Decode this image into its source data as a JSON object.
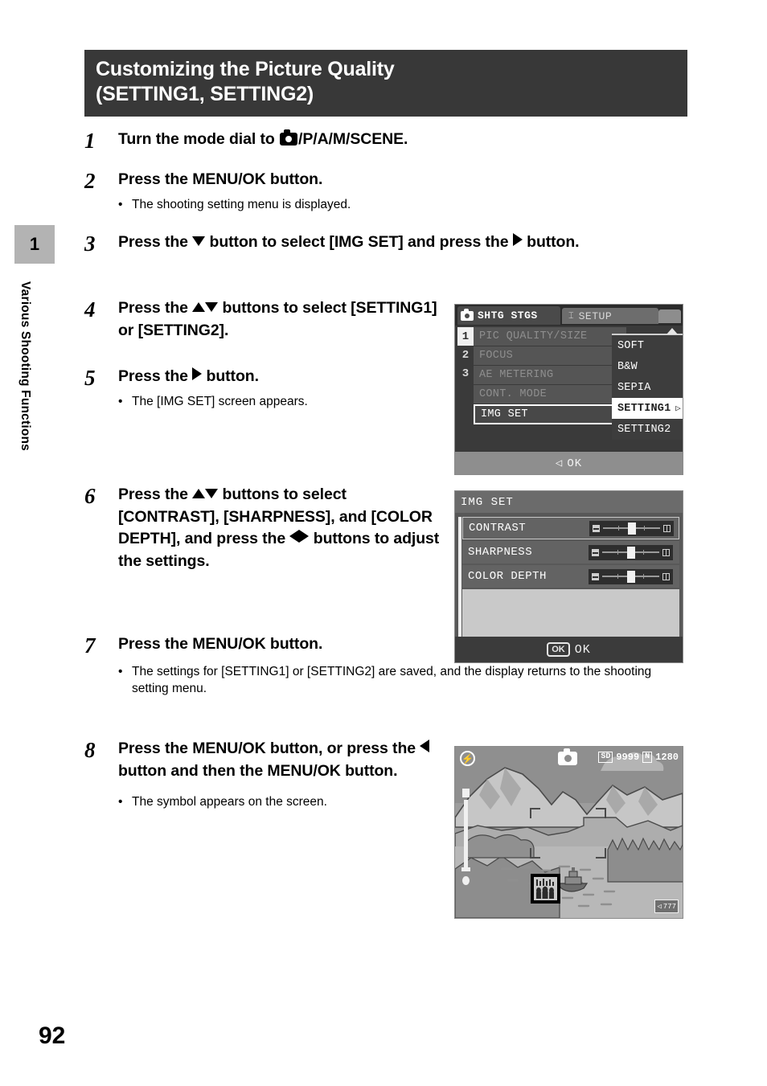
{
  "sidebar": {
    "chapter_number": "1",
    "chapter_title": "Various Shooting Functions"
  },
  "header": {
    "line1": "Customizing the Picture Quality",
    "line2": "(SETTING1, SETTING2)",
    "background": "#383838"
  },
  "page_number": "92",
  "steps": [
    {
      "number": "1",
      "text_before": "Turn the mode dial to ",
      "text_after": "/P/A/M/SCENE.",
      "bullets": []
    },
    {
      "number": "2",
      "text_before": "Press the MENU/OK button.",
      "text_after": "",
      "bullets": [
        "The shooting setting menu is displayed."
      ]
    },
    {
      "number": "3",
      "text_before": "Press the ",
      "text_mid": " button to select [IMG SET] and press the ",
      "text_after": " button.",
      "bullets": []
    },
    {
      "number": "4",
      "text_before": "Press the ",
      "text_after": " buttons to select [SETTING1] or [SETTING2].",
      "bullets": []
    },
    {
      "number": "5",
      "text_before": "Press the ",
      "text_after": " button.",
      "bullets": [
        "The [IMG SET] screen appears."
      ]
    },
    {
      "number": "6",
      "text_before": "Press the ",
      "text_mid": " buttons to select [CONTRAST], [SHARPNESS], and [COLOR DEPTH], and press the ",
      "text_after": " buttons to adjust the settings.",
      "bullets": []
    },
    {
      "number": "7",
      "text_before": "Press the MENU/OK button.",
      "text_after": "",
      "bullets": [
        "The settings for [SETTING1] or [SETTING2] are saved, and the display returns to the shooting setting menu."
      ]
    },
    {
      "number": "8",
      "text_before": "Press the MENU/OK button, or press the ",
      "text_after": " button and then the MENU/OK button.",
      "bullets": [
        "The symbol appears on the screen."
      ]
    }
  ],
  "menu_screen": {
    "tab_shooting": "SHTG STGS",
    "tab_setup": "SETUP",
    "pages": [
      "1",
      "2",
      "3"
    ],
    "selected_page": "1",
    "items": [
      "PIC QUALITY/SIZE",
      "FOCUS",
      "AE METERING",
      "CONT. MODE",
      "IMG SET"
    ],
    "active_item": "IMG SET",
    "submenu": [
      "SOFT",
      "B&W",
      "SEPIA",
      "SETTING1",
      "SETTING2"
    ],
    "submenu_selected": "SETTING1",
    "footer_label": "OK"
  },
  "imgset_screen": {
    "title": "IMG SET",
    "rows": [
      {
        "label": "CONTRAST",
        "value": 50,
        "selected": true
      },
      {
        "label": "SHARPNESS",
        "value": 50,
        "selected": false
      },
      {
        "label": "COLOR DEPTH",
        "value": 50,
        "selected": false
      }
    ],
    "ok_chip": "OK",
    "footer_label": "OK"
  },
  "photo_screen": {
    "card_icon": "SD",
    "shots_remaining": "9999",
    "quality_icon": "N",
    "image_size": "1280",
    "badge": "777"
  }
}
